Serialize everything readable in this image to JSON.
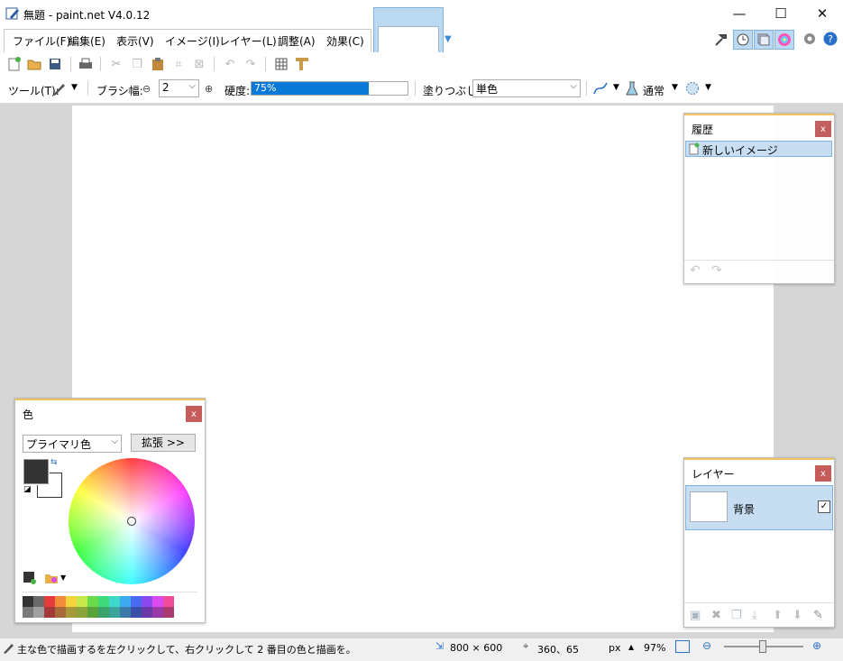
{
  "window": {
    "title": "無題 - paint.net V4.0.12",
    "minimize": "—",
    "maximize": "☐",
    "close": "✕"
  },
  "menu": [
    "ファイル(F)",
    "編集(E)",
    "表示(V)",
    "イメージ(I)",
    "レイヤー(L)",
    "調整(A)",
    "効果(C)"
  ],
  "toolbar2": {
    "tool_label": "ツール(T):",
    "brush_width_label": "ブラシ幅:",
    "brush_width_value": "2",
    "hardness_label": "硬度:",
    "hardness_value": "75%",
    "hardness_fraction": 0.75,
    "fill_label": "塗りつぶし:",
    "fill_value": "単色",
    "blend_mode": "通常"
  },
  "history_panel": {
    "title": "履歴",
    "close": "x",
    "items": [
      "新しいイメージ"
    ]
  },
  "colors_panel": {
    "title": "色",
    "close": "x",
    "mode_select": "プライマリ色",
    "expand_button": "拡張 >>",
    "primary_color": "#333333",
    "secondary_color": "#ffffff"
  },
  "layers_panel": {
    "title": "レイヤー",
    "close": "x",
    "layers": [
      {
        "name": "背景",
        "visible": true
      }
    ]
  },
  "statusbar": {
    "hint": "主な色で描画するを左クリックして、右クリックして 2 番目の色と描画を。",
    "image_size": "800 × 600",
    "cursor_pos": "360、65",
    "unit": "px",
    "zoom": "97%"
  },
  "colors": {
    "accent": "#0a78d7",
    "selection": "#c7ddf2",
    "panel_header_line": "#f1c35e",
    "close_button": "#c45c5c",
    "palette_top": [
      "#333333",
      "#6a6a6a",
      "#e53b3b",
      "#f08c3a",
      "#f5d33c",
      "#c7e84a",
      "#6ad94a",
      "#3fd97c",
      "#3fd9c9",
      "#3fa9f0",
      "#4a6af0",
      "#8a4af0",
      "#d94af0",
      "#f04a9a"
    ],
    "palette_bottom": [
      "#7a7a7a",
      "#a0a0a0",
      "#a33a3a",
      "#a86a3a",
      "#a89a3a",
      "#8aa33a",
      "#5aa33a",
      "#3aa36a",
      "#3aa39a",
      "#3a7aa8",
      "#3a50a8",
      "#6a3aa8",
      "#9a3aa8",
      "#a83a70"
    ]
  }
}
